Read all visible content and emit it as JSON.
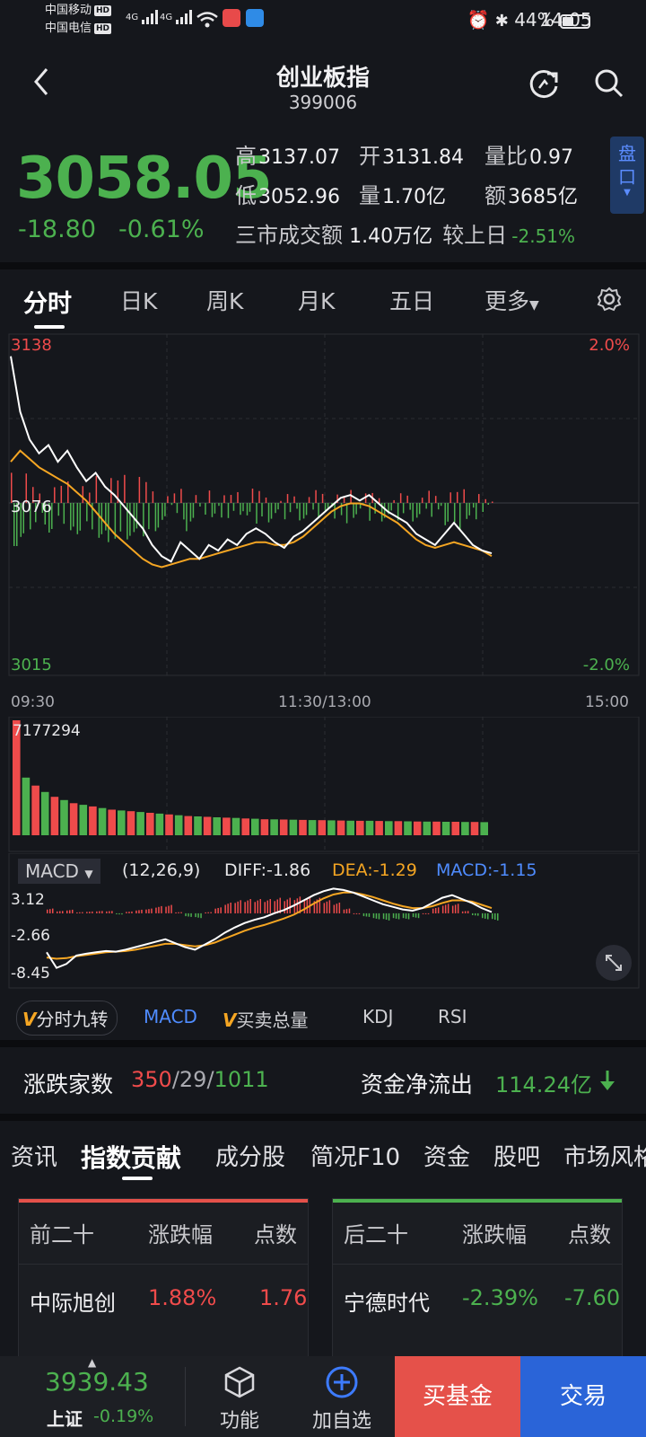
{
  "status_bar": {
    "carrier1": "中国移动",
    "carrier2": "中国电信",
    "hd": "HD",
    "net1": "4G",
    "net2": "4G",
    "battery": "44%",
    "time": "14:05"
  },
  "header": {
    "title": "创业板指",
    "code": "399006"
  },
  "quote": {
    "price": "3058.05",
    "change": "-18.80",
    "change_pct": "-0.61%",
    "high_label": "高",
    "high": "3137.07",
    "open_label": "开",
    "open": "3131.84",
    "vol_ratio_label": "量比",
    "vol_ratio": "0.97",
    "low_label": "低",
    "low": "3052.96",
    "volume_label": "量",
    "volume": "1.70亿",
    "amount_label": "额",
    "amount": "3685亿",
    "market_turnover_label": "三市成交额",
    "market_turnover": "1.40万亿",
    "vs_prev_label": "较上日",
    "vs_prev": "-2.51%",
    "pankou_label": "盘口"
  },
  "chart_tabs": [
    "分时",
    "日K",
    "周K",
    "月K",
    "五日",
    "更多"
  ],
  "chart_data": [
    {
      "type": "line",
      "title": "",
      "series": [],
      "y_left_ticks": [
        "3138",
        "3076",
        "3015"
      ],
      "y_right_ticks": [
        "2.0%",
        "-2.0%"
      ],
      "x_ticks": [
        "09:30",
        "11:30/13:00",
        "15:00"
      ],
      "ylim": [
        3015,
        3138
      ],
      "price_line": [
        3130,
        3110,
        3100,
        3095,
        3098,
        3092,
        3096,
        3090,
        3085,
        3088,
        3083,
        3080,
        3076,
        3072,
        3068,
        3062,
        3058,
        3056,
        3063,
        3060,
        3057,
        3062,
        3060,
        3064,
        3062,
        3066,
        3068,
        3066,
        3063,
        3061,
        3065,
        3067,
        3070,
        3073,
        3076,
        3079,
        3080,
        3078,
        3080,
        3077,
        3074,
        3072,
        3070,
        3066,
        3064,
        3062,
        3066,
        3070,
        3066,
        3062,
        3060,
        3059
      ],
      "avg_line": [
        3092,
        3096,
        3093,
        3090,
        3088,
        3086,
        3084,
        3081,
        3078,
        3074,
        3070,
        3066,
        3063,
        3060,
        3057,
        3055,
        3054,
        3055,
        3056,
        3057,
        3057,
        3058,
        3059,
        3060,
        3061,
        3062,
        3063,
        3063,
        3062,
        3062,
        3063,
        3065,
        3068,
        3071,
        3074,
        3076,
        3077,
        3077,
        3076,
        3074,
        3072,
        3070,
        3067,
        3064,
        3062,
        3061,
        3062,
        3063,
        3062,
        3061,
        3060,
        3058
      ]
    },
    {
      "type": "bar",
      "title": "",
      "y_max_label": "7177294",
      "values": [
        7177294,
        3600000,
        3100000,
        2700000,
        2400000,
        2200000,
        2000000,
        1900000,
        1800000,
        1700000,
        1600000,
        1550000,
        1500000,
        1450000,
        1400000,
        1350000,
        1300000,
        1250000,
        1200000,
        1180000,
        1150000,
        1120000,
        1100000,
        1080000,
        1050000,
        1030000,
        1000000,
        990000,
        980000,
        970000,
        960000,
        950000,
        940000,
        930000,
        920000,
        910000,
        900000,
        900000,
        890000,
        880000,
        880000,
        870000,
        860000,
        850000,
        850000,
        840000,
        840000,
        830000,
        830000,
        820000
      ]
    },
    {
      "type": "line",
      "title": "",
      "indicator": "MACD",
      "params": "(12,26,9)",
      "diff_label": "DIFF:-1.86",
      "dea_label": "DEA:-1.29",
      "macd_label": "MACD:-1.15",
      "y_ticks": [
        "3.12",
        "-2.66",
        "-8.45"
      ],
      "ylim": [
        -9,
        4
      ],
      "diff": [
        -6,
        -8.4,
        -7.8,
        -6.5,
        -6.2,
        -6.0,
        -5.8,
        -5.9,
        -5.6,
        -5.2,
        -4.8,
        -4.4,
        -4.0,
        -4.6,
        -5.2,
        -5.6,
        -4.8,
        -4.0,
        -3.0,
        -2.2,
        -1.5,
        -1.0,
        -0.6,
        0.0,
        0.5,
        1.2,
        2.0,
        2.8,
        3.4,
        3.8,
        3.6,
        3.2,
        2.6,
        2.0,
        1.4,
        1.0,
        0.6,
        0.4,
        0.8,
        1.6,
        2.4,
        2.8,
        2.2,
        1.6,
        0.8,
        0.2
      ],
      "dea": [
        -6.8,
        -7.0,
        -6.9,
        -6.6,
        -6.4,
        -6.2,
        -6.0,
        -5.9,
        -5.8,
        -5.6,
        -5.3,
        -5.0,
        -4.7,
        -4.7,
        -4.9,
        -5.1,
        -4.9,
        -4.5,
        -3.9,
        -3.3,
        -2.7,
        -2.2,
        -1.8,
        -1.3,
        -0.8,
        -0.2,
        0.6,
        1.5,
        2.3,
        2.9,
        3.2,
        3.2,
        2.9,
        2.5,
        2.0,
        1.5,
        1.1,
        0.8,
        0.8,
        1.1,
        1.6,
        2.0,
        2.0,
        1.8,
        1.3,
        0.8
      ],
      "macd_bars": [
        0.8,
        0.4,
        0.6,
        0.2,
        0.3,
        0.4,
        0.4,
        -0.2,
        0.3,
        0.6,
        0.8,
        1.2,
        1.4,
        0.2,
        -0.6,
        -0.8,
        0.2,
        1.0,
        1.8,
        2.2,
        2.4,
        2.4,
        2.4,
        2.6,
        2.6,
        2.8,
        2.8,
        2.6,
        2.2,
        1.8,
        0.8,
        0.0,
        -0.6,
        -1.0,
        -1.2,
        -1.0,
        -1.0,
        -0.8,
        0.0,
        1.0,
        1.6,
        1.6,
        0.4,
        -0.4,
        -1.0,
        -1.2
      ]
    }
  ],
  "indicator_tabs": [
    "分时九转",
    "MACD",
    "买卖总量",
    "KDJ",
    "RSI"
  ],
  "breadth": {
    "label": "涨跌家数",
    "up": "350",
    "sep1": "/",
    "flat": "29",
    "sep2": "/",
    "down": "1011",
    "flow_label": "资金净流出",
    "flow_value": "114.24亿"
  },
  "content_tabs": [
    "资讯",
    "指数贡献",
    "成分股",
    "简况F10",
    "资金",
    "股吧",
    "市场风格"
  ],
  "top_contrib": {
    "headers": [
      "前二十",
      "涨跌幅",
      "点数"
    ],
    "rows": [
      {
        "name": "中际旭创",
        "pct": "1.88%",
        "points": "1.76"
      }
    ]
  },
  "bottom_contrib": {
    "headers": [
      "后二十",
      "涨跌幅",
      "点数"
    ],
    "rows": [
      {
        "name": "宁德时代",
        "pct": "-2.39%",
        "points": "-7.60"
      }
    ]
  },
  "bottom_bar": {
    "sh_value": "3939.43",
    "sh_label": "上证",
    "sh_change": "-0.19%",
    "func_label": "功能",
    "add_label": "加自选",
    "buy_fund_label": "买基金",
    "trade_label": "交易"
  },
  "colors": {
    "up": "#ef4b4b",
    "down": "#4cb14f",
    "avg_line": "#f5a623",
    "buy_fund_bg": "#e5514a",
    "trade_bg": "#2a64d8",
    "background": "#15171c"
  }
}
